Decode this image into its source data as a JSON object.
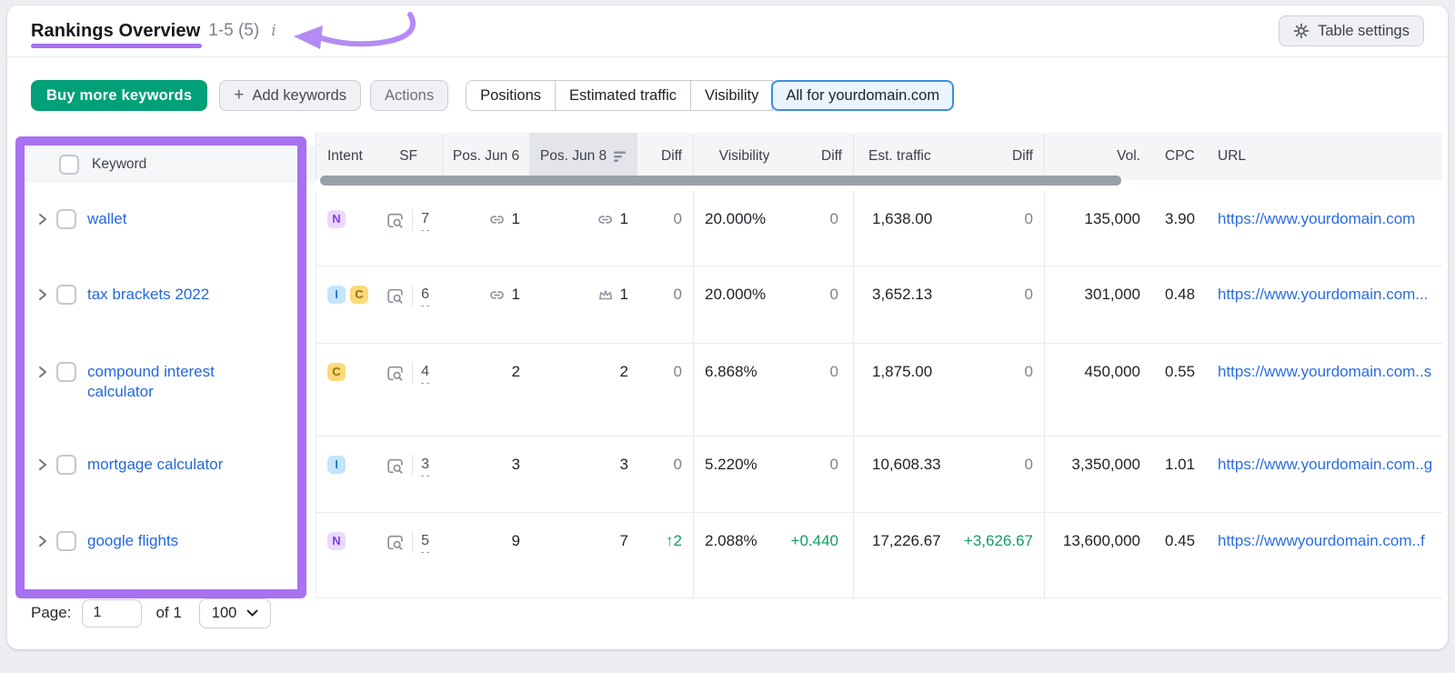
{
  "header": {
    "title": "Rankings Overview",
    "range": "1-5 (5)",
    "info": "i",
    "table_settings": "Table settings"
  },
  "toolbar": {
    "buy": "Buy more keywords",
    "add_plus": "+",
    "add": "Add keywords",
    "actions": "Actions",
    "segments": [
      {
        "label": "Positions",
        "active": false
      },
      {
        "label": "Estimated traffic",
        "active": false
      },
      {
        "label": "Visibility",
        "active": false
      },
      {
        "label": "All for yourdomain.com",
        "active": true
      }
    ]
  },
  "table": {
    "headers": {
      "keyword": "Keyword",
      "intent": "Intent",
      "sf": "SF",
      "pos_jun6": "Pos. Jun 6",
      "pos_jun8": "Pos. Jun 8",
      "diff_pos": "Diff",
      "visibility": "Visibility",
      "diff_vis": "Diff",
      "est_traffic": "Est. traffic",
      "diff_est": "Diff",
      "vol": "Vol.",
      "cpc": "CPC",
      "url": "URL"
    },
    "sorted_column": "Pos. Jun 8",
    "rows": [
      {
        "keyword": "wallet",
        "intents": [
          "N"
        ],
        "sf": "7",
        "pos_jun6": "1",
        "pos_jun6_icon": "link-icon",
        "pos_jun8": "1",
        "pos_jun8_icon": "link-icon",
        "diff": "0",
        "visibility": "20.000%",
        "vis_diff": "0",
        "est_traffic": "1,638.00",
        "est_diff": "0",
        "volume": "135,000",
        "cpc": "3.90",
        "url": "https://www.yourdomain.com"
      },
      {
        "keyword": "tax brackets 2022",
        "intents": [
          "I",
          "C"
        ],
        "sf": "6",
        "pos_jun6": "1",
        "pos_jun6_icon": "link-icon",
        "pos_jun8": "1",
        "pos_jun8_icon": "crown-icon",
        "diff": "0",
        "visibility": "20.000%",
        "vis_diff": "0",
        "est_traffic": "3,652.13",
        "est_diff": "0",
        "volume": "301,000",
        "cpc": "0.48",
        "url": "https://www.yourdomain.com..."
      },
      {
        "keyword": "compound interest calculator",
        "intents": [
          "C"
        ],
        "sf": "4",
        "pos_jun6": "2",
        "pos_jun8": "2",
        "diff": "0",
        "visibility": "6.868%",
        "vis_diff": "0",
        "est_traffic": "1,875.00",
        "est_diff": "0",
        "volume": "450,000",
        "cpc": "0.55",
        "url": "https://www.yourdomain.com..s"
      },
      {
        "keyword": "mortgage calculator",
        "intents": [
          "I"
        ],
        "sf": "3",
        "pos_jun6": "3",
        "pos_jun8": "3",
        "diff": "0",
        "visibility": "5.220%",
        "vis_diff": "0",
        "est_traffic": "10,608.33",
        "est_diff": "0",
        "volume": "3,350,000",
        "cpc": "1.01",
        "url": "https://www.yourdomain.com..g"
      },
      {
        "keyword": "google flights",
        "intents": [
          "N"
        ],
        "sf": "5",
        "pos_jun6": "9",
        "pos_jun8": "7",
        "diff": "↑2",
        "visibility": "2.088%",
        "vis_diff": "+0.440",
        "est_traffic": "17,226.67",
        "est_diff": "+3,626.67",
        "volume": "13,600,000",
        "cpc": "0.45",
        "url": "https://wwwyourdomain.com..f"
      }
    ]
  },
  "footer": {
    "page_label": "Page:",
    "page_value": "1",
    "of_label": "of 1",
    "page_size": "100"
  },
  "colors": {
    "annotation_purple": "#a871f0",
    "primary_green": "#00a078",
    "active_segment_blue": "#3e8ee0",
    "link_blue": "#2368dd",
    "positive_green": "#169a64",
    "badge_informational": "#c4e5fa",
    "badge_commercial": "#fada79",
    "badge_navigational": "#ead9fc"
  }
}
